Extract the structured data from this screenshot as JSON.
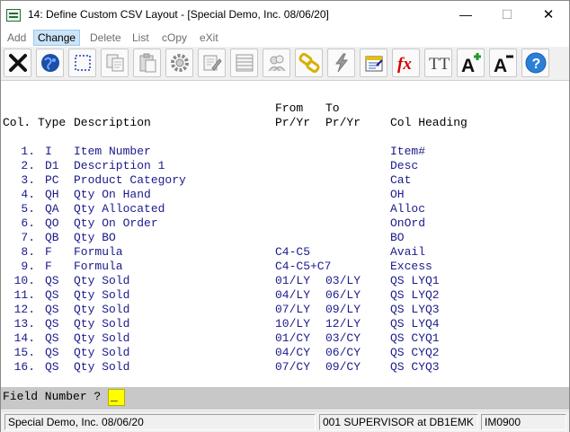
{
  "window": {
    "title": "14: Define Custom CSV Layout - [Special Demo, Inc. 08/06/20]",
    "minimize_glyph": "—",
    "maximize_glyph": "☐",
    "close_glyph": "✕"
  },
  "menu": {
    "items": [
      {
        "label": "Add",
        "active": false
      },
      {
        "label": "Change",
        "active": true
      },
      {
        "label": "Delete",
        "active": false
      },
      {
        "label": "List",
        "active": false
      },
      {
        "label": "cOpy",
        "active": false
      },
      {
        "label": "eXit",
        "active": false
      }
    ]
  },
  "toolbar": {
    "icons": [
      "close-x-icon",
      "globe-icon",
      "select-box-icon",
      "copy-icon",
      "paste-icon",
      "gear-icon",
      "edit-form-icon",
      "list-icon",
      "users-icon",
      "chain-link-icon",
      "lightning-icon",
      "calendar-icon",
      "fx-formula-icon",
      "text-style-icon",
      "font-increase-icon",
      "font-decrease-icon",
      "help-icon"
    ],
    "fx_label": "fx",
    "tt_label": "TT",
    "a_plus_label": "A",
    "a_minus_label": "A",
    "help_label": "?"
  },
  "table": {
    "headers": {
      "col": "Col.",
      "type": "Type",
      "description": "Description",
      "from_top": "From",
      "from_bottom": "Pr/Yr",
      "to_top": "To",
      "to_bottom": "Pr/Yr",
      "col_heading": "Col Heading"
    },
    "rows": [
      {
        "col": "1.",
        "type": "I",
        "description": "Item Number",
        "from": "",
        "to": "",
        "heading": "Item#"
      },
      {
        "col": "2.",
        "type": "D1",
        "description": "Description 1",
        "from": "",
        "to": "",
        "heading": "Desc"
      },
      {
        "col": "3.",
        "type": "PC",
        "description": "Product Category",
        "from": "",
        "to": "",
        "heading": "Cat"
      },
      {
        "col": "4.",
        "type": "QH",
        "description": "Qty On Hand",
        "from": "",
        "to": "",
        "heading": "OH"
      },
      {
        "col": "5.",
        "type": "QA",
        "description": "Qty Allocated",
        "from": "",
        "to": "",
        "heading": "Alloc"
      },
      {
        "col": "6.",
        "type": "QO",
        "description": "Qty On Order",
        "from": "",
        "to": "",
        "heading": "OnOrd"
      },
      {
        "col": "7.",
        "type": "QB",
        "description": "Qty BO",
        "from": "",
        "to": "",
        "heading": "BO"
      },
      {
        "col": "8.",
        "type": "F",
        "description": "Formula",
        "from": "C4-C5",
        "to": "",
        "heading": "Avail"
      },
      {
        "col": "9.",
        "type": "F",
        "description": "Formula",
        "from": "C4-C5+C7",
        "to": "",
        "heading": "Excess"
      },
      {
        "col": "10.",
        "type": "QS",
        "description": "Qty Sold",
        "from": "01/LY",
        "to": "03/LY",
        "heading": "QS LYQ1"
      },
      {
        "col": "11.",
        "type": "QS",
        "description": "Qty Sold",
        "from": "04/LY",
        "to": "06/LY",
        "heading": "QS LYQ2"
      },
      {
        "col": "12.",
        "type": "QS",
        "description": "Qty Sold",
        "from": "07/LY",
        "to": "09/LY",
        "heading": "QS LYQ3"
      },
      {
        "col": "13.",
        "type": "QS",
        "description": "Qty Sold",
        "from": "10/LY",
        "to": "12/LY",
        "heading": "QS LYQ4"
      },
      {
        "col": "14.",
        "type": "QS",
        "description": "Qty Sold",
        "from": "01/CY",
        "to": "03/CY",
        "heading": "QS CYQ1"
      },
      {
        "col": "15.",
        "type": "QS",
        "description": "Qty Sold",
        "from": "04/CY",
        "to": "06/CY",
        "heading": "QS CYQ2"
      },
      {
        "col": "16.",
        "type": "QS",
        "description": "Qty Sold",
        "from": "07/CY",
        "to": "09/CY",
        "heading": "QS CYQ3"
      }
    ]
  },
  "prompt": {
    "label": "Field Number ?",
    "value": "_"
  },
  "status": {
    "company": "Special Demo, Inc. 08/06/20",
    "user": "001 SUPERVISOR at DB1EMK",
    "program": "IM0900"
  },
  "colors": {
    "data_text": "#1a1a8c",
    "prompt_input": "#ffff00",
    "prompt_bar": "#c8c8c8",
    "menu_active": "#cce4f7"
  }
}
